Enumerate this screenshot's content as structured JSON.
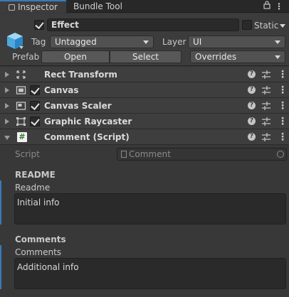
{
  "tabs": [
    {
      "label": "Inspector",
      "active": true
    },
    {
      "label": "Bundle Tool",
      "active": false
    }
  ],
  "tabbar_icons": [
    "lock-icon",
    "more-icon"
  ],
  "gameobject": {
    "name": "Effect",
    "active": true,
    "static_label": "Static",
    "static_checked": false,
    "tag_label": "Tag",
    "tag_value": "Untagged",
    "layer_label": "Layer",
    "layer_value": "UI",
    "prefab_label": "Prefab",
    "prefab_open": "Open",
    "prefab_select": "Select",
    "prefab_overrides": "Overrides"
  },
  "components": [
    {
      "title": "Rect Transform",
      "icon": "rect-transform-icon",
      "has_checkbox": false,
      "expanded": false
    },
    {
      "title": "Canvas",
      "icon": "canvas-icon",
      "has_checkbox": true,
      "checked": true,
      "expanded": false
    },
    {
      "title": "Canvas Scaler",
      "icon": "canvas-scaler-icon",
      "has_checkbox": true,
      "checked": true,
      "expanded": false
    },
    {
      "title": "Graphic Raycaster",
      "icon": "graphic-raycaster-icon",
      "has_checkbox": true,
      "checked": true,
      "expanded": false
    },
    {
      "title": "Comment (Script)",
      "icon": "script-icon",
      "has_checkbox": false,
      "expanded": true
    }
  ],
  "comment_script": {
    "script_label": "Script",
    "script_value": "Comment",
    "readme_header": "README",
    "readme_label": "Readme",
    "readme_value": "Initial info",
    "comments_header": "Comments",
    "comments_label": "Comments",
    "comments_value": "Additional info"
  },
  "colors": {
    "panel_bg": "#383838",
    "accent_blue": "#3a79bb",
    "header_bg": "#3c3c3c",
    "field_bg": "#2a2a2a"
  }
}
